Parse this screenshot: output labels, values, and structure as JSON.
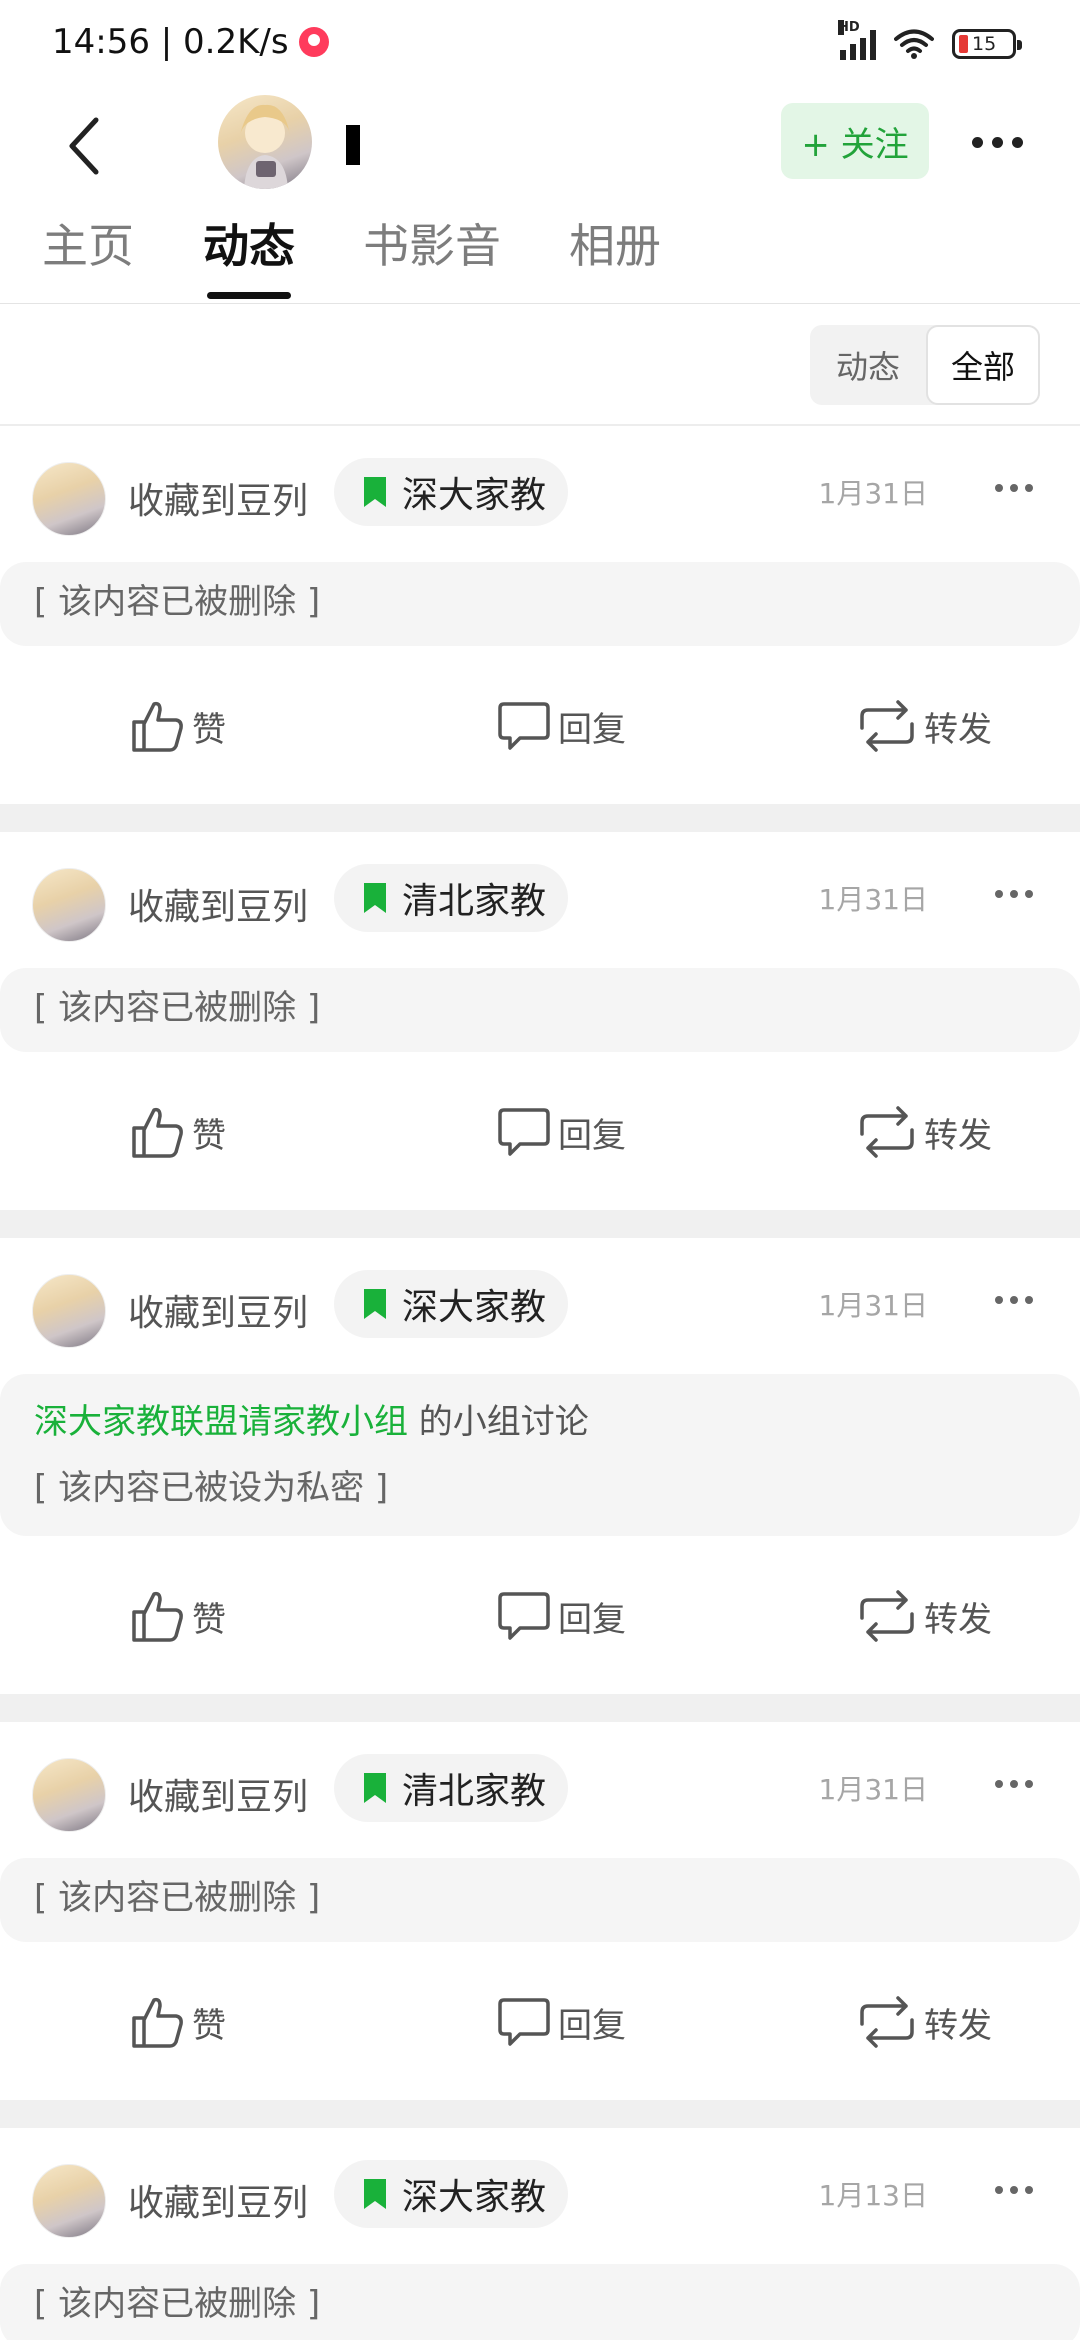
{
  "status_bar": {
    "time_speed": "14:56 | 0.2K/s",
    "battery": "15",
    "network_label": "HD"
  },
  "header": {
    "follow_label": "+ 关注"
  },
  "tabs": [
    {
      "label": "主页"
    },
    {
      "label": "动态"
    },
    {
      "label": "书影音"
    },
    {
      "label": "相册"
    }
  ],
  "filter": {
    "options": [
      "动态",
      "全部"
    ],
    "selected": "全部"
  },
  "posts": [
    {
      "action": "收藏到豆列",
      "tag": "深大家教",
      "date": "1月31日",
      "content": "[ 该内容已被删除 ]"
    },
    {
      "action": "收藏到豆列",
      "tag": "清北家教",
      "date": "1月31日",
      "content": "[ 该内容已被删除 ]"
    },
    {
      "action": "收藏到豆列",
      "tag": "深大家教",
      "date": "1月31日",
      "group_link": "深大家教联盟请家教小组",
      "group_suffix": " 的小组讨论",
      "content": "[ 该内容已被设为私密 ]"
    },
    {
      "action": "收藏到豆列",
      "tag": "清北家教",
      "date": "1月31日",
      "content": "[ 该内容已被删除 ]"
    },
    {
      "action": "收藏到豆列",
      "tag": "深大家教",
      "date": "1月13日",
      "content": "[ 该内容已被删除 ]"
    }
  ],
  "actions": {
    "like": "赞",
    "reply": "回复",
    "share": "转发"
  },
  "colors": {
    "accent_green": "#19b13a",
    "follow_bg": "#e3f6e6"
  }
}
